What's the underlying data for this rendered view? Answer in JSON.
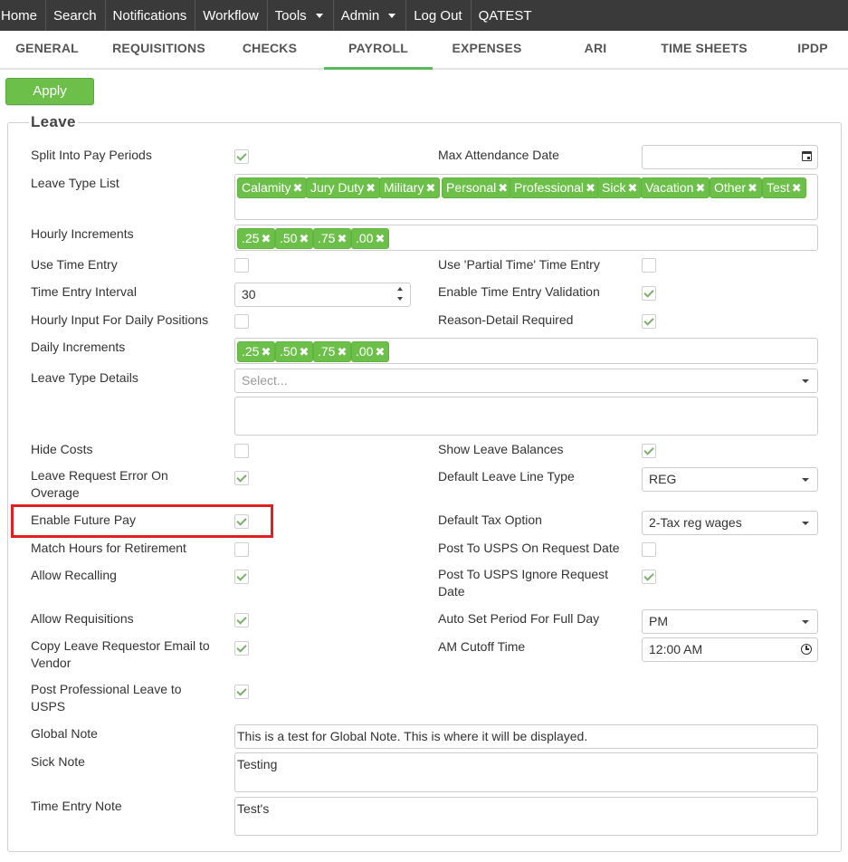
{
  "nav": {
    "home": "Home",
    "search": "Search",
    "notifications": "Notifications",
    "workflow": "Workflow",
    "tools": "Tools",
    "admin": "Admin",
    "logout": "Log Out",
    "user": "QATEST"
  },
  "tabs": [
    "GENERAL",
    "REQUISITIONS",
    "CHECKS",
    "PAYROLL",
    "EXPENSES",
    "ARI",
    "TIME SHEETS",
    "IPDP"
  ],
  "active_tab": "PAYROLL",
  "apply_label": "Apply",
  "section_title": "Leave",
  "labels": {
    "split_into_pay_periods": "Split Into Pay Periods",
    "max_attendance_date": "Max Attendance Date",
    "leave_type_list": "Leave Type List",
    "hourly_increments": "Hourly Increments",
    "use_time_entry": "Use Time Entry",
    "use_partial_time_entry": "Use 'Partial Time' Time Entry",
    "time_entry_interval": "Time Entry Interval",
    "enable_time_entry_validation": "Enable Time Entry Validation",
    "hourly_input_daily_positions": "Hourly Input For Daily Positions",
    "reason_detail_required": "Reason-Detail Required",
    "daily_increments": "Daily Increments",
    "leave_type_details": "Leave Type Details",
    "hide_costs": "Hide Costs",
    "show_leave_balances": "Show Leave Balances",
    "leave_request_error_line1": "Leave Request Error On",
    "leave_request_error_line2": "Overage",
    "default_leave_line_type": "Default Leave Line Type",
    "enable_future_pay": "Enable Future Pay",
    "default_tax_option": "Default Tax Option",
    "match_hours_retirement": "Match Hours for Retirement",
    "post_usps_on_request_date": "Post To USPS On Request Date",
    "allow_recalling": "Allow Recalling",
    "post_usps_ignore_line1": "Post To USPS Ignore Request",
    "post_usps_ignore_line2": "Date",
    "allow_requisitions": "Allow Requisitions",
    "auto_set_period": "Auto Set Period For Full Day",
    "copy_email_line1": "Copy Leave Requestor Email to",
    "copy_email_line2": "Vendor",
    "am_cutoff_time": "AM Cutoff Time",
    "post_professional_line1": "Post Professional Leave to",
    "post_professional_line2": "USPS",
    "global_note": "Global Note",
    "sick_note": "Sick Note",
    "time_entry_note": "Time Entry Note"
  },
  "values": {
    "leave_types": [
      "Calamity",
      "Jury Duty",
      "Military",
      "Personal",
      "Professional",
      "Sick",
      "Vacation",
      "Other",
      "Test"
    ],
    "hourly_increments": [
      ".25",
      ".50",
      ".75",
      ".00"
    ],
    "daily_increments": [
      ".25",
      ".50",
      ".75",
      ".00"
    ],
    "time_entry_interval": "30",
    "leave_type_details_placeholder": "Select...",
    "default_leave_line_type": "REG",
    "default_tax_option": "2-Tax reg wages",
    "auto_set_period": "PM",
    "am_cutoff_time": "12:00 AM",
    "global_note": "This is a test for Global Note. This is where it will be displayed.",
    "sick_note": "Testing",
    "time_entry_note": "Test's"
  },
  "checkboxes": {
    "split_into_pay_periods": true,
    "use_time_entry": false,
    "use_partial_time_entry": false,
    "enable_time_entry_validation": true,
    "hourly_input_daily_positions": false,
    "reason_detail_required": true,
    "hide_costs": false,
    "show_leave_balances": true,
    "leave_request_error": true,
    "enable_future_pay": true,
    "match_hours_retirement": false,
    "post_usps_on_request_date": false,
    "allow_recalling": true,
    "post_usps_ignore": true,
    "allow_requisitions": true,
    "copy_email": true,
    "post_professional": true
  },
  "colors": {
    "accent_green": "#6cc04a",
    "nav_bg": "#3a3a3a",
    "highlight_red": "#e02020"
  }
}
